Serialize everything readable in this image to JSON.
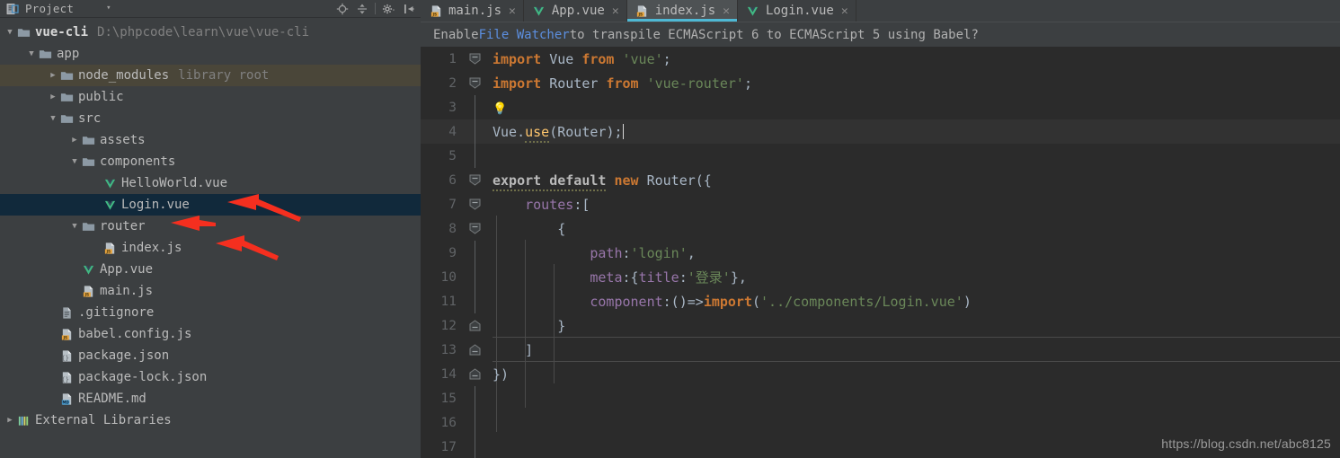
{
  "project_panel": {
    "header": {
      "title": "Project",
      "icon": "project-view-icon",
      "caret": "▾",
      "tools": [
        {
          "name": "locate-icon",
          "glyph": "locate"
        },
        {
          "name": "collapse-all-icon",
          "glyph": "collapse"
        },
        {
          "name": "settings-gear-icon",
          "glyph": "gear"
        },
        {
          "name": "hide-panel-icon",
          "glyph": "hide"
        }
      ]
    },
    "tree": [
      {
        "depth": 0,
        "twisty": "▼",
        "icon": "folder-icon",
        "label": "vue-cli",
        "bold": true,
        "sub": "D:\\phpcode\\learn\\vue\\vue-cli",
        "state": "normal"
      },
      {
        "depth": 1,
        "twisty": "▼",
        "icon": "folder-icon",
        "label": "app",
        "bold": false,
        "sub": "",
        "state": "normal"
      },
      {
        "depth": 2,
        "twisty": "▶",
        "icon": "folder-icon",
        "label": "node_modules",
        "bold": false,
        "sub": "library root",
        "state": "hovered"
      },
      {
        "depth": 2,
        "twisty": "▶",
        "icon": "folder-icon",
        "label": "public",
        "bold": false,
        "sub": "",
        "state": "normal"
      },
      {
        "depth": 2,
        "twisty": "▼",
        "icon": "folder-icon",
        "label": "src",
        "bold": false,
        "sub": "",
        "state": "normal"
      },
      {
        "depth": 3,
        "twisty": "▶",
        "icon": "folder-icon",
        "label": "assets",
        "bold": false,
        "sub": "",
        "state": "normal"
      },
      {
        "depth": 3,
        "twisty": "▼",
        "icon": "folder-icon",
        "label": "components",
        "bold": false,
        "sub": "",
        "state": "normal"
      },
      {
        "depth": 4,
        "twisty": "",
        "icon": "vue-file-icon",
        "label": "HelloWorld.vue",
        "bold": false,
        "sub": "",
        "state": "normal"
      },
      {
        "depth": 4,
        "twisty": "",
        "icon": "vue-file-icon",
        "label": "Login.vue",
        "bold": false,
        "sub": "",
        "state": "selected"
      },
      {
        "depth": 3,
        "twisty": "▼",
        "icon": "folder-icon",
        "label": "router",
        "bold": false,
        "sub": "",
        "state": "normal"
      },
      {
        "depth": 4,
        "twisty": "",
        "icon": "js-file-icon",
        "label": "index.js",
        "bold": false,
        "sub": "",
        "state": "normal"
      },
      {
        "depth": 3,
        "twisty": "",
        "icon": "vue-file-icon",
        "label": "App.vue",
        "bold": false,
        "sub": "",
        "state": "normal"
      },
      {
        "depth": 3,
        "twisty": "",
        "icon": "js-file-icon",
        "label": "main.js",
        "bold": false,
        "sub": "",
        "state": "normal"
      },
      {
        "depth": 2,
        "twisty": "",
        "icon": "text-file-icon",
        "label": ".gitignore",
        "bold": false,
        "sub": "",
        "state": "normal"
      },
      {
        "depth": 2,
        "twisty": "",
        "icon": "js-file-icon",
        "label": "babel.config.js",
        "bold": false,
        "sub": "",
        "state": "normal"
      },
      {
        "depth": 2,
        "twisty": "",
        "icon": "json-file-icon",
        "label": "package.json",
        "bold": false,
        "sub": "",
        "state": "normal"
      },
      {
        "depth": 2,
        "twisty": "",
        "icon": "json-file-icon",
        "label": "package-lock.json",
        "bold": false,
        "sub": "",
        "state": "normal"
      },
      {
        "depth": 2,
        "twisty": "",
        "icon": "md-file-icon",
        "label": "README.md",
        "bold": false,
        "sub": "",
        "state": "normal"
      },
      {
        "depth": 0,
        "twisty": "▶",
        "icon": "libraries-icon",
        "label": "External Libraries",
        "bold": false,
        "sub": "",
        "state": "normal"
      }
    ],
    "annotations": {
      "color": "#f52f1f",
      "arrows": [
        {
          "name": "arrow-to-login-vue",
          "target": "Login.vue"
        },
        {
          "name": "arrow-to-router-folder",
          "target": "router"
        },
        {
          "name": "arrow-to-index-js",
          "target": "index.js"
        }
      ]
    }
  },
  "editor": {
    "tabs": [
      {
        "label": "main.js",
        "icon": "js-file-icon",
        "active": false,
        "close": "✕"
      },
      {
        "label": "App.vue",
        "icon": "vue-file-icon",
        "active": false,
        "close": "✕"
      },
      {
        "label": "index.js",
        "icon": "js-file-icon",
        "active": true,
        "close": "✕"
      },
      {
        "label": "Login.vue",
        "icon": "vue-file-icon",
        "active": false,
        "close": "✕"
      }
    ],
    "active_tab_accent": "#4eb8d4",
    "notification": {
      "prefix": "Enable ",
      "link": "File Watcher",
      "suffix": " to transpile ECMAScript 6 to ECMAScript 5 using Babel?"
    },
    "lines": [
      {
        "no": "1",
        "text": "import Vue from 'vue';"
      },
      {
        "no": "2",
        "text": "import Router from 'vue-router';"
      },
      {
        "no": "3",
        "text": ""
      },
      {
        "no": "4",
        "text": "Vue.use(Router);"
      },
      {
        "no": "5",
        "text": ""
      },
      {
        "no": "6",
        "text": "export default new Router({"
      },
      {
        "no": "7",
        "text": "    routes:["
      },
      {
        "no": "8",
        "text": "        {"
      },
      {
        "no": "9",
        "text": "            path:'login',"
      },
      {
        "no": "10",
        "text": "            meta:{title:'登录'},"
      },
      {
        "no": "11",
        "text": "            component:()=>import('../components/Login.vue')"
      },
      {
        "no": "12",
        "text": "        }"
      },
      {
        "no": "13",
        "text": "    ]"
      },
      {
        "no": "14",
        "text": "})"
      },
      {
        "no": "15",
        "text": ""
      },
      {
        "no": "16",
        "text": ""
      },
      {
        "no": "17",
        "text": ""
      }
    ],
    "intention_bulb": "💡",
    "current_line": "4"
  },
  "watermark": "https://blog.csdn.net/abc8125"
}
